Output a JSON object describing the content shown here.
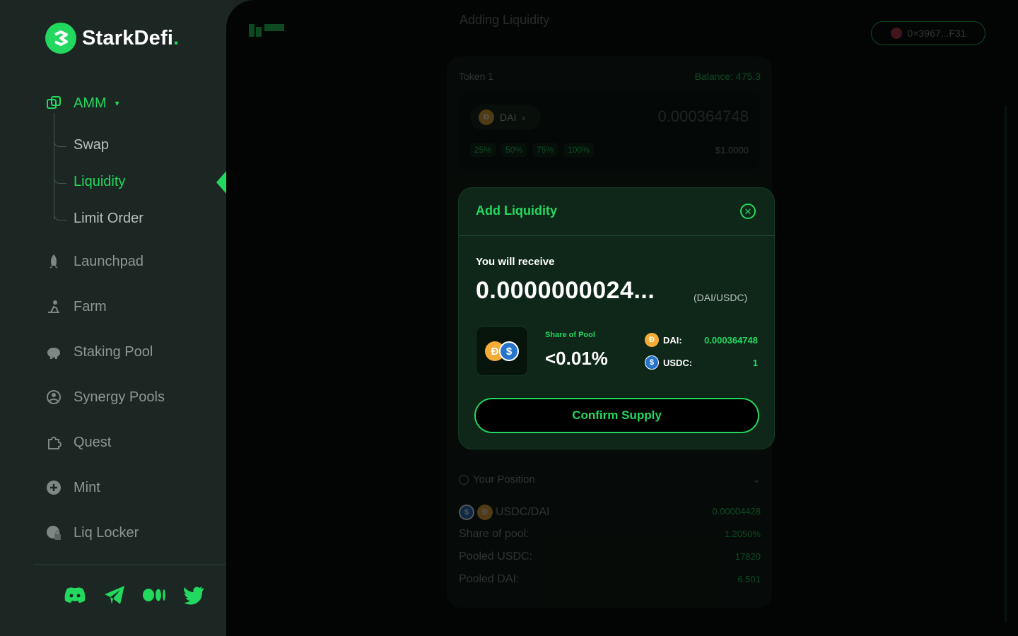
{
  "brand": {
    "name": "StarkDefi",
    "dot": "."
  },
  "sidebar": {
    "amm": "AMM",
    "sub": [
      "Swap",
      "Liquidity",
      "Limit Order"
    ],
    "items": [
      "Launchpad",
      "Farm",
      "Staking Pool",
      "Synergy Pools",
      "Quest",
      "Mint",
      "Liq Locker"
    ]
  },
  "header": {
    "title": "Adding Liquidity",
    "wallet": "0×3967...F31"
  },
  "token1": {
    "label": "Token 1",
    "balance": "Balance: 475.3",
    "symbol": "DAI",
    "amount": "0.000364748",
    "percents": [
      "25%",
      "50%",
      "75%",
      "100%"
    ],
    "usd": "$1.0000"
  },
  "position": {
    "title": "Your Position",
    "pair": "USDC/DAI",
    "pair_value": "0.00004428",
    "rows": [
      {
        "label": "Share of pool:",
        "value": "1.2050%"
      },
      {
        "label": "Pooled USDC:",
        "value": "17820"
      },
      {
        "label": "Pooled DAI:",
        "value": "6.501"
      }
    ]
  },
  "modal": {
    "title": "Add Liquidity",
    "receive_label": "You will receive",
    "receive_amount": "0.0000000024...",
    "receive_pair": "(DAI/USDC)",
    "share_label": "Share of Pool",
    "share_value": "<0.01%",
    "dai_label": "DAI:",
    "dai_value": "0.000364748",
    "usdc_label": "USDC:",
    "usdc_value": "1",
    "confirm_label": "Confirm Supply"
  },
  "colors": {
    "accent": "#22d85f",
    "background": "#030504",
    "sidebar": "#1c2622",
    "modal": "#0e2719"
  }
}
